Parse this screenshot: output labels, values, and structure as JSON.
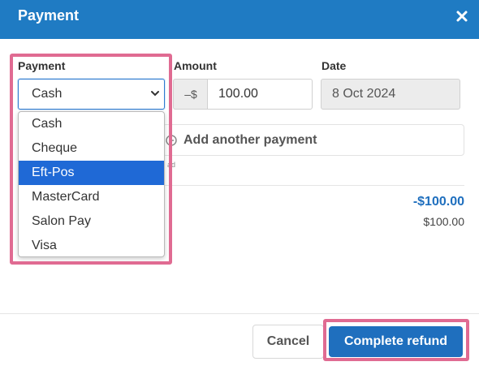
{
  "dialog": {
    "title": "Payment",
    "close_icon": "close-icon"
  },
  "form": {
    "payment_label": "Payment",
    "payment_selected": "Cash",
    "amount_label": "Amount",
    "amount_prefix": "–$",
    "amount_value": "100.00",
    "date_label": "Date",
    "date_value": "8 Oct 2024",
    "add_payment_label": "Add another payment",
    "hint_fragment": "ad"
  },
  "dropdown": {
    "options": [
      "Cash",
      "Cheque",
      "Eft-Pos",
      "MasterCard",
      "Salon Pay",
      "Visa"
    ],
    "selected_option": "Eft-Pos"
  },
  "summary": {
    "refund_total": "-$100.00",
    "amount_total": "$100.00"
  },
  "footer": {
    "cancel_label": "Cancel",
    "complete_label": "Complete refund"
  },
  "colors": {
    "header": "#1f7bc3",
    "primary_button": "#1f6fbe",
    "selected_option": "#1f69d6",
    "highlight": "#e06b92",
    "refund_text": "#1f6fbe"
  }
}
